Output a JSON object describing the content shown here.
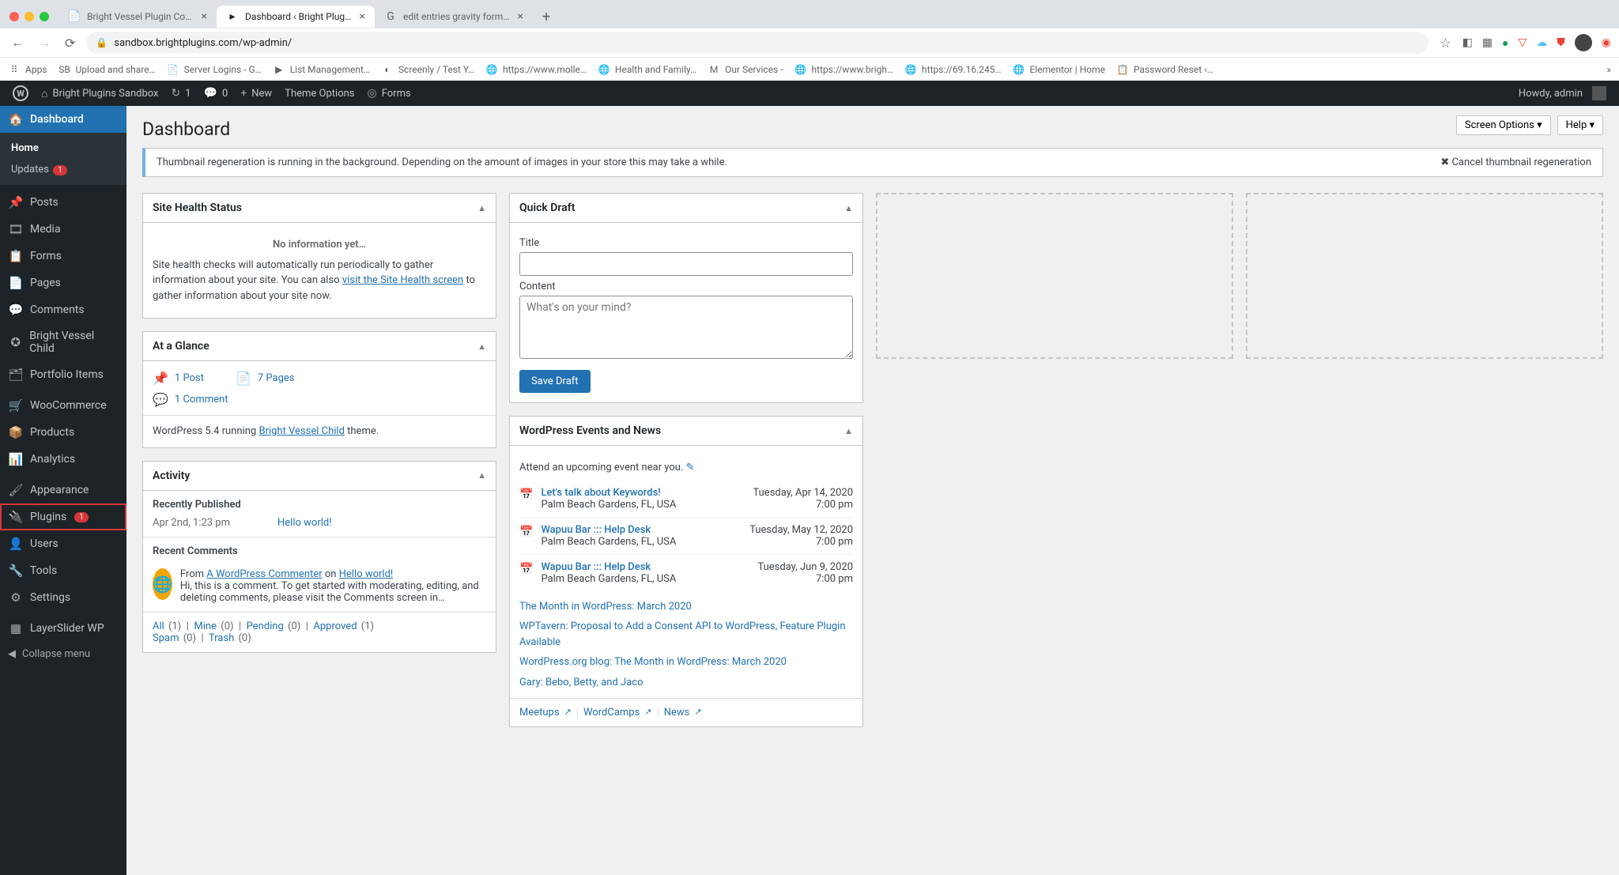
{
  "browser": {
    "tabs": [
      {
        "favicon": "📄",
        "title": "Bright Vessel Plugin Copy - Go"
      },
      {
        "favicon": "▸",
        "title": "Dashboard ‹ Bright Plugins Sa…",
        "active": true
      },
      {
        "favicon": "G",
        "title": "edit entries gravity forms - Go"
      }
    ],
    "url": "sandbox.brightplugins.com/wp-admin/",
    "bookmarks": [
      {
        "ico": "⠿",
        "label": "Apps"
      },
      {
        "ico": "SB",
        "label": "Upload and share…"
      },
      {
        "ico": "📄",
        "label": "Server Logins - G…"
      },
      {
        "ico": "▶",
        "label": "List Management…"
      },
      {
        "ico": "◐",
        "label": "Screenly / Test Y…"
      },
      {
        "ico": "🌐",
        "label": "https://www.molle…"
      },
      {
        "ico": "🌐",
        "label": "Health and Family…"
      },
      {
        "ico": "M",
        "label": "Our Services -"
      },
      {
        "ico": "🌐",
        "label": "https://www.brigh…"
      },
      {
        "ico": "🌐",
        "label": "https://69.16.245…"
      },
      {
        "ico": "🌐",
        "label": "Elementor | Home"
      },
      {
        "ico": "📋",
        "label": "Password Reset ‹…"
      }
    ]
  },
  "adminbar": {
    "site": "Bright Plugins Sandbox",
    "updates": "1",
    "comments": "0",
    "new": "New",
    "theme": "Theme Options",
    "forms": "Forms",
    "howdy": "Howdy, admin"
  },
  "menu": {
    "dashboard": "Dashboard",
    "sub_home": "Home",
    "sub_updates": "Updates",
    "sub_updates_count": "1",
    "items": [
      {
        "ico": "📌",
        "label": "Posts"
      },
      {
        "ico": "🎞",
        "label": "Media"
      },
      {
        "ico": "📋",
        "label": "Forms"
      },
      {
        "ico": "📄",
        "label": "Pages"
      },
      {
        "ico": "💬",
        "label": "Comments"
      },
      {
        "ico": "✪",
        "label": "Bright Vessel Child"
      },
      {
        "ico": "🗂",
        "label": "Portfolio Items"
      }
    ],
    "items2": [
      {
        "ico": "🛒",
        "label": "WooCommerce"
      },
      {
        "ico": "📦",
        "label": "Products"
      },
      {
        "ico": "📊",
        "label": "Analytics"
      }
    ],
    "items3": [
      {
        "ico": "🖌",
        "label": "Appearance"
      },
      {
        "ico": "🔌",
        "label": "Plugins",
        "badge": "1",
        "hl": true
      },
      {
        "ico": "👤",
        "label": "Users"
      },
      {
        "ico": "🔧",
        "label": "Tools"
      },
      {
        "ico": "⚙",
        "label": "Settings"
      }
    ],
    "items4": [
      {
        "ico": "▦",
        "label": "LayerSlider WP"
      }
    ],
    "collapse": "Collapse menu"
  },
  "page": {
    "title": "Dashboard",
    "screen_options": "Screen Options ▾",
    "help": "Help ▾",
    "notice": "Thumbnail regeneration is running in the background. Depending on the amount of images in your store this may take a while.",
    "cancel": "✖ Cancel thumbnail regeneration"
  },
  "site_health": {
    "title": "Site Health Status",
    "noinfo": "No information yet…",
    "text1": "Site health checks will automatically run periodically to gather information about your site. You can also ",
    "link": "visit the Site Health screen",
    "text2": " to gather information about your site now."
  },
  "glance": {
    "title": "At a Glance",
    "posts": "1 Post",
    "pages": "7 Pages",
    "comments": "1 Comment",
    "wp_ver": "WordPress 5.4 running ",
    "theme": "Bright Vessel Child",
    "wp_ver2": " theme."
  },
  "activity": {
    "title": "Activity",
    "recently_pub": "Recently Published",
    "pub_date": "Apr 2nd, 1:23 pm",
    "pub_title": "Hello world!",
    "recent_comments": "Recent Comments",
    "comm_from": "From ",
    "comm_author": "A WordPress Commenter",
    "comm_on": " on ",
    "comm_post": "Hello world!",
    "comm_body": "Hi, this is a comment. To get started with moderating, editing, and deleting comments, please visit the Comments screen in…",
    "filters": {
      "all": "All",
      "all_n": "(1)",
      "mine": "Mine",
      "mine_n": "(0)",
      "pending": "Pending",
      "pending_n": "(0)",
      "approved": "Approved",
      "approved_n": "(1)",
      "spam": "Spam",
      "spam_n": "(0)",
      "trash": "Trash",
      "trash_n": "(0)"
    }
  },
  "quickdraft": {
    "title": "Quick Draft",
    "label_title": "Title",
    "label_content": "Content",
    "placeholder": "What's on your mind?",
    "save": "Save Draft"
  },
  "events": {
    "title": "WordPress Events and News",
    "attend": "Attend an upcoming event near you. ",
    "list": [
      {
        "name": "Let's talk about Keywords!",
        "loc": "Palm Beach Gardens, FL, USA",
        "date": "Tuesday, Apr 14, 2020",
        "time": "7:00 pm"
      },
      {
        "name": "Wapuu Bar ::: Help Desk",
        "loc": "Palm Beach Gardens, FL, USA",
        "date": "Tuesday, May 12, 2020",
        "time": "7:00 pm"
      },
      {
        "name": "Wapuu Bar ::: Help Desk",
        "loc": "Palm Beach Gardens, FL, USA",
        "date": "Tuesday, Jun 9, 2020",
        "time": "7:00 pm"
      }
    ],
    "news": [
      "The Month in WordPress: March 2020",
      "WPTavern: Proposal to Add a Consent API to WordPress, Feature Plugin Available",
      "WordPress.org blog: The Month in WordPress: March 2020",
      "Gary: Bebo, Betty, and Jaco"
    ],
    "foot": {
      "meetups": "Meetups",
      "wordcamps": "WordCamps",
      "news": "News"
    }
  }
}
